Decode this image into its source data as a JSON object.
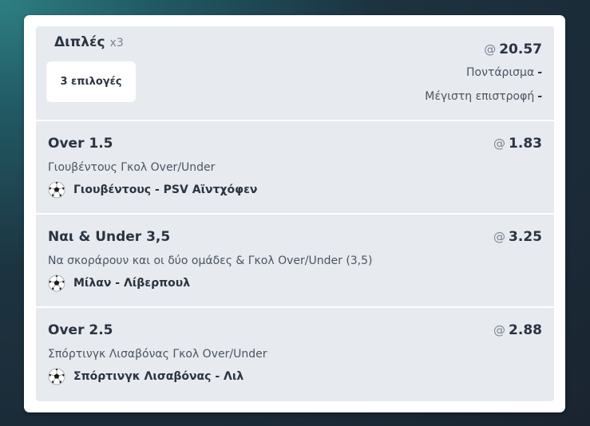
{
  "summary": {
    "title": "Διπλές",
    "multiplier": "x3",
    "picks_button": "3 επιλογές",
    "odds_prefix": "@",
    "total_odds": "20.57",
    "stake_label": "Ποντάρισμα",
    "stake_value": "-",
    "max_return_label": "Μέγιστη επιστροφή",
    "max_return_value": "-"
  },
  "selections": [
    {
      "market": "Over 1.5",
      "odds": "1.83",
      "description": "Γιουβέντους Γκολ Over/Under",
      "event": "Γιουβέντους - PSV Αϊντχόφεν",
      "icon": "soccer-ball-icon"
    },
    {
      "market": "Ναι & Under 3,5",
      "odds": "3.25",
      "description": "Να σκοράρουν και οι δύο ομάδες & Γκολ Over/Under (3,5)",
      "event": "Μίλαν - Λίβερπουλ",
      "icon": "soccer-ball-icon"
    },
    {
      "market": "Over 2.5",
      "odds": "2.88",
      "description": "Σπόρτινγκ Λισαβόνας Γκολ Over/Under",
      "event": "Σπόρτινγκ Λισαβόνας - Λιλ",
      "icon": "soccer-ball-icon"
    }
  ],
  "colors": {
    "card_background": "#ffffff",
    "panel_background": "#e7eaee",
    "text_primary": "#2a3441",
    "text_secondary": "#4a5563",
    "text_muted": "#7a8593"
  }
}
